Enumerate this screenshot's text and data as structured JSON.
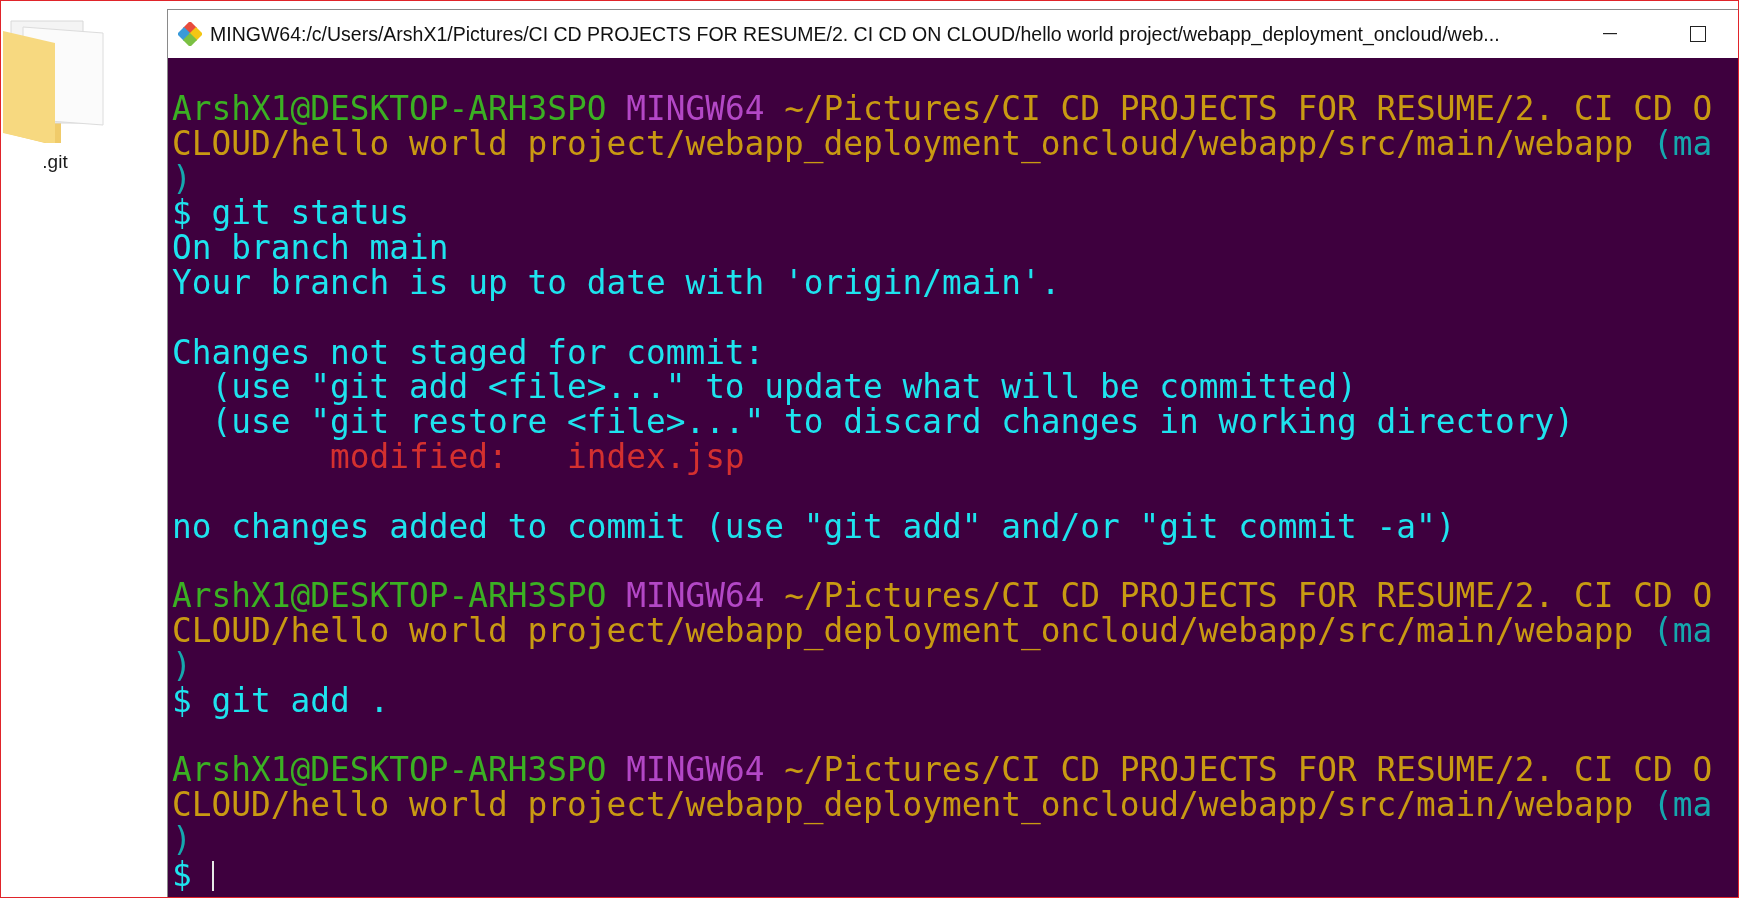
{
  "desktop": {
    "icons": [
      {
        "label": ".git"
      }
    ]
  },
  "window": {
    "title": "MINGW64:/c/Users/ArshX1/Pictures/CI CD PROJECTS FOR RESUME/2. CI CD ON CLOUD/hello world project/webapp_deployment_oncloud/web...",
    "buttons": [
      {
        "kind": "minimize"
      },
      {
        "kind": "maximize"
      }
    ]
  },
  "terminal": {
    "cursor_visible": true,
    "lines": [
      {
        "kind": "text",
        "segments": [
          {
            "kind": "user",
            "text": "ArshX1@DESKTOP-ARH3SPO"
          },
          {
            "kind": "host",
            "text": "MINGW64"
          },
          {
            "kind": "path",
            "text": "~/Pictures/CI CD PROJECTS FOR RESUME/2. CI CD O"
          }
        ]
      },
      {
        "kind": "text",
        "segments": [
          {
            "kind": "path",
            "text": "CLOUD/hello world project/webapp_deployment_oncloud/webapp/src/main/webapp"
          },
          {
            "kind": "branch",
            "text": "(ma"
          }
        ]
      },
      {
        "kind": "text",
        "segments": [
          {
            "kind": "branch",
            "text": ")"
          }
        ]
      },
      {
        "kind": "text",
        "segments": [
          {
            "kind": "command",
            "text": "$ git status"
          }
        ]
      },
      {
        "kind": "text",
        "segments": [
          {
            "kind": "output",
            "text": "On branch main"
          }
        ]
      },
      {
        "kind": "text",
        "segments": [
          {
            "kind": "output",
            "text": "Your branch is up to date with 'origin/main'."
          }
        ]
      },
      {
        "kind": "blank"
      },
      {
        "kind": "text",
        "segments": [
          {
            "kind": "output",
            "text": "Changes not staged for commit:"
          }
        ]
      },
      {
        "kind": "text",
        "segments": [
          {
            "kind": "output",
            "text": "  (use \"git add <file>...\" to update what will be committed)"
          }
        ]
      },
      {
        "kind": "text",
        "segments": [
          {
            "kind": "output",
            "text": "  (use \"git restore <file>...\" to discard changes in working directory)"
          }
        ]
      },
      {
        "kind": "text",
        "segments": [
          {
            "kind": "modified",
            "text": "        modified:   index.jsp"
          }
        ]
      },
      {
        "kind": "blank"
      },
      {
        "kind": "text",
        "segments": [
          {
            "kind": "output",
            "text": "no changes added to commit (use \"git add\" and/or \"git commit -a\")"
          }
        ]
      },
      {
        "kind": "blank"
      },
      {
        "kind": "text",
        "segments": [
          {
            "kind": "user",
            "text": "ArshX1@DESKTOP-ARH3SPO"
          },
          {
            "kind": "host",
            "text": "MINGW64"
          },
          {
            "kind": "path",
            "text": "~/Pictures/CI CD PROJECTS FOR RESUME/2. CI CD O"
          }
        ]
      },
      {
        "kind": "text",
        "segments": [
          {
            "kind": "path",
            "text": "CLOUD/hello world project/webapp_deployment_oncloud/webapp/src/main/webapp"
          },
          {
            "kind": "branch",
            "text": "(ma"
          }
        ]
      },
      {
        "kind": "text",
        "segments": [
          {
            "kind": "branch",
            "text": ")"
          }
        ]
      },
      {
        "kind": "text",
        "segments": [
          {
            "kind": "command",
            "text": "$ git add ."
          }
        ]
      },
      {
        "kind": "blank"
      },
      {
        "kind": "text",
        "segments": [
          {
            "kind": "user",
            "text": "ArshX1@DESKTOP-ARH3SPO"
          },
          {
            "kind": "host",
            "text": "MINGW64"
          },
          {
            "kind": "path",
            "text": "~/Pictures/CI CD PROJECTS FOR RESUME/2. CI CD O"
          }
        ]
      },
      {
        "kind": "text",
        "segments": [
          {
            "kind": "path",
            "text": "CLOUD/hello world project/webapp_deployment_oncloud/webapp/src/main/webapp"
          },
          {
            "kind": "branch",
            "text": "(ma"
          }
        ]
      },
      {
        "kind": "text",
        "segments": [
          {
            "kind": "branch",
            "text": ")"
          }
        ]
      },
      {
        "kind": "prompt",
        "segments": [
          {
            "kind": "command",
            "text": "$"
          }
        ]
      }
    ]
  }
}
